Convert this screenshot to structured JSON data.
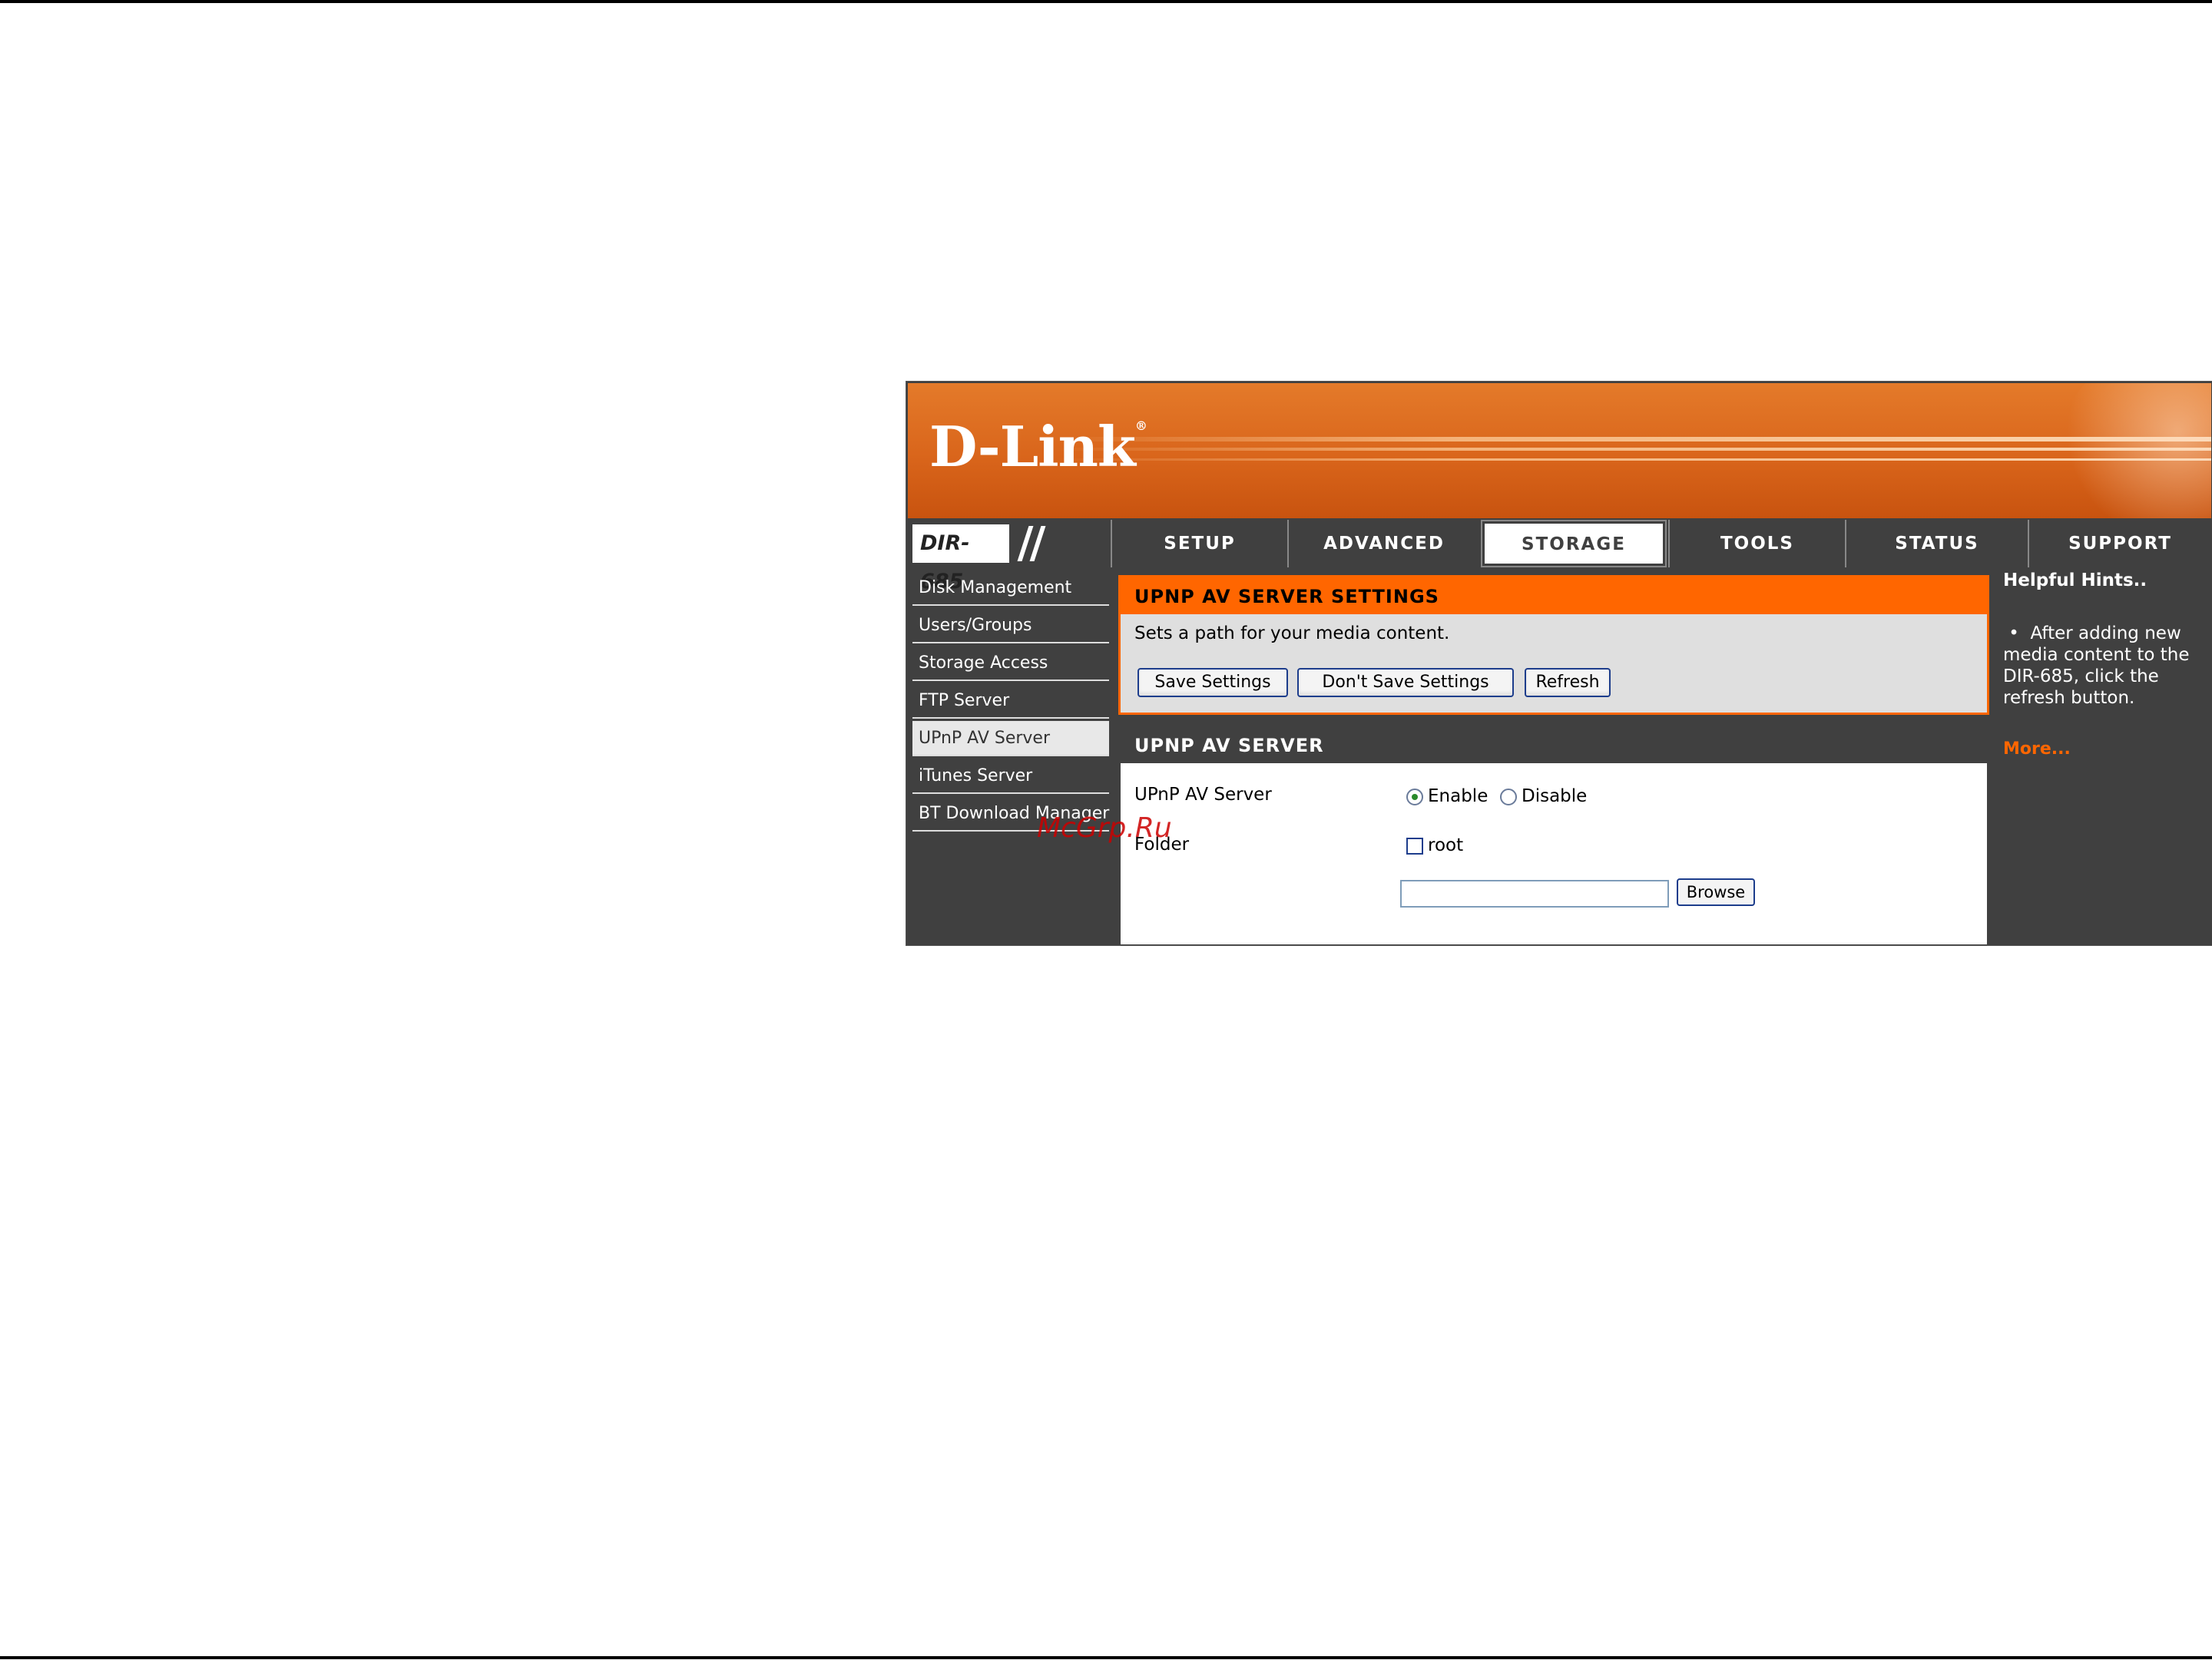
{
  "brand": {
    "logo_text": "D-Link",
    "model": "DIR-685"
  },
  "nav": {
    "tabs": [
      {
        "label": "SETUP"
      },
      {
        "label": "ADVANCED"
      },
      {
        "label": "STORAGE"
      },
      {
        "label": "TOOLS"
      },
      {
        "label": "STATUS"
      },
      {
        "label": "SUPPORT"
      }
    ],
    "active_tab": "STORAGE"
  },
  "sidebar": {
    "items": [
      {
        "label": "Disk Management"
      },
      {
        "label": "Users/Groups"
      },
      {
        "label": "Storage Access"
      },
      {
        "label": "FTP Server"
      },
      {
        "label": "UPnP AV Server"
      },
      {
        "label": "iTunes Server"
      },
      {
        "label": "BT Download Manager"
      }
    ],
    "active_item": "UPnP AV Server"
  },
  "settings": {
    "title": "UPNP AV SERVER SETTINGS",
    "description": "Sets a path for your media content.",
    "save_label": "Save Settings",
    "dont_save_label": "Don't Save Settings",
    "refresh_label": "Refresh"
  },
  "server": {
    "title": "UPNP AV SERVER",
    "server_label": "UPnP AV Server",
    "enable_label": "Enable",
    "disable_label": "Disable",
    "selected": "Enable",
    "folder_label": "Folder",
    "root_label": "root",
    "root_checked": false,
    "folder_value": "",
    "browse_label": "Browse"
  },
  "hints": {
    "title": "Helpful Hints..",
    "body": "After adding new media content to the DIR-685, click the refresh button.",
    "more_label": "More..."
  },
  "watermark": "McGrp.Ru",
  "colors": {
    "accent": "#ff6600",
    "nav_bg": "#404040",
    "panel_bg": "#dfdfdf"
  }
}
